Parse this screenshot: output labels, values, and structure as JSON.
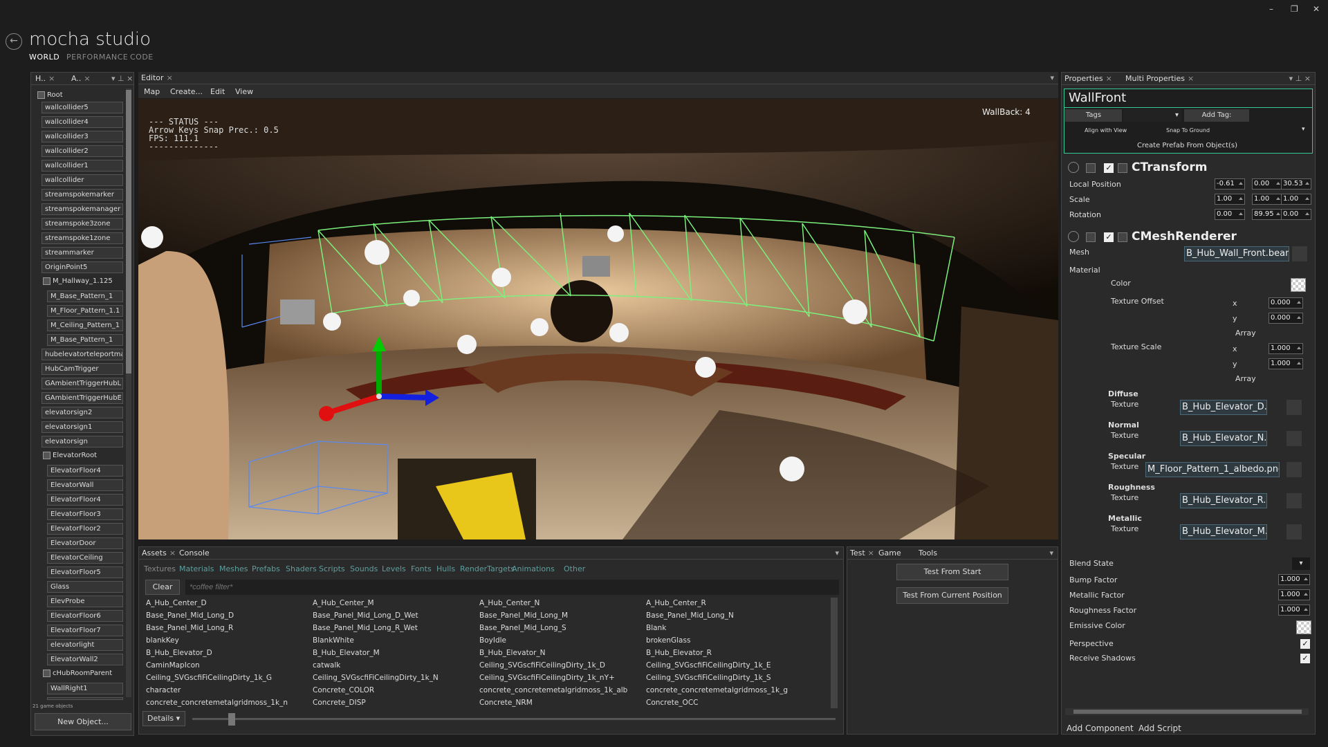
{
  "app": {
    "title": "mocha studio",
    "nav": [
      "WORLD",
      "PERFORMANCE",
      "CODE"
    ]
  },
  "window_controls": {
    "minimize": "–",
    "restore": "❐",
    "close": "✕"
  },
  "hierarchy": {
    "tabs": [
      "H..",
      "A.."
    ],
    "items": [
      "wallcollider5",
      "wallcollider4",
      "wallcollider3",
      "wallcollider2",
      "wallcollider1",
      "wallcollider",
      "streamspokemarker",
      "streamspokemanager",
      "streamspoke3zone",
      "streamspoke1zone",
      "streammarker",
      "OriginPoint5"
    ],
    "hallway_label": "M_Hallway_1.125",
    "hallway_children": [
      "M_Base_Pattern_1",
      "M_Floor_Pattern_1.1",
      "M_Ceiling_Pattern_1",
      "M_Base_Pattern_1"
    ],
    "items2": [
      "hubelevatorteleportma",
      "HubCamTrigger",
      "GAmbientTriggerHubL",
      "GAmbientTriggerHubE",
      "elevatorsign2",
      "elevatorsign1",
      "elevatorsign"
    ],
    "elevator_label": "ElevatorRoot",
    "elevator_children": [
      "ElevatorFloor4",
      "ElevatorWall",
      "ElevatorFloor4",
      "ElevatorFloor3",
      "ElevatorFloor2",
      "ElevatorDoor",
      "ElevatorCeiling",
      "ElevatorFloor5",
      "Glass",
      "ElevProbe",
      "ElevatorFloor6",
      "ElevatorFloor7",
      "elevatorlight",
      "ElevatorWall2"
    ],
    "hubroom_label": "cHubRoomParent",
    "hubroom_children": [
      "WallRight1",
      "WallRight"
    ],
    "root_label": "Root",
    "footer_count": "21 game objects",
    "new_object": "New Object..."
  },
  "editor": {
    "tab": "Editor",
    "menus": [
      "Map",
      "Create...",
      "Edit",
      "View"
    ],
    "status": "--- STATUS ---\nArrow Keys Snap Prec.: 0.5\nFPS: 111.1\n--------------",
    "overlay_label": "WallBack: 4"
  },
  "assets": {
    "tabs": [
      "Assets",
      "Console"
    ],
    "filters": [
      "Textures",
      "Materials",
      "Meshes",
      "Prefabs",
      "Shaders",
      "Scripts",
      "Sounds",
      "Levels",
      "Fonts",
      "Hulls",
      "RenderTargets",
      "Animations",
      "Other"
    ],
    "clear": "Clear",
    "filter_placeholder": "*coffee filter*",
    "rows": [
      [
        "A_Hub_Center_D",
        "A_Hub_Center_M",
        "A_Hub_Center_N",
        "A_Hub_Center_R"
      ],
      [
        "Base_Panel_Mid_Long_D",
        "Base_Panel_Mid_Long_D_Wet",
        "Base_Panel_Mid_Long_M",
        "Base_Panel_Mid_Long_N"
      ],
      [
        "Base_Panel_Mid_Long_R",
        "Base_Panel_Mid_Long_R_Wet",
        "Base_Panel_Mid_Long_S",
        "Blank"
      ],
      [
        "blankKey",
        "BlankWhite",
        "BoyIdle",
        "brokenGlass"
      ],
      [
        "B_Hub_Elevator_D",
        "B_Hub_Elevator_M",
        "B_Hub_Elevator_N",
        "B_Hub_Elevator_R"
      ],
      [
        "CaminMapIcon",
        "catwalk",
        "Ceiling_SVGscfiFiCeilingDirty_1k_D",
        "Ceiling_SVGscfiFiCeilingDirty_1k_E"
      ],
      [
        "Ceiling_SVGscfiFiCeilingDirty_1k_G",
        "Ceiling_SVGscfiFiCeilingDirty_1k_N",
        "Ceiling_SVGscfiFiCeilingDirty_1k_nY+",
        "Ceiling_SVGscfiFiCeilingDirty_1k_S"
      ],
      [
        "character",
        "Concrete_COLOR",
        "concrete_concretemetalgridmoss_1k_alb",
        "concrete_concretemetalgridmoss_1k_g"
      ],
      [
        "concrete_concretemetalgridmoss_1k_n",
        "Concrete_DISP",
        "Concrete_NRM",
        "Concrete_OCC"
      ]
    ],
    "details": "Details"
  },
  "test": {
    "tabs": [
      "Test",
      "Game",
      "Tools"
    ],
    "start": "Test From Start",
    "current": "Test From Current Position"
  },
  "properties": {
    "tabs": [
      "Properties",
      "Multi Properties"
    ],
    "object_name": "WallFront",
    "tags": "Tags",
    "add_tag": "Add Tag:",
    "align": "Align with View",
    "snap": "Snap To Ground",
    "prefab": "Create Prefab From Object(s)",
    "transform": {
      "name": "CTransform",
      "local_position_label": "Local Position",
      "local_position": [
        "-0.61",
        "0.00",
        "30.53"
      ],
      "scale_label": "Scale",
      "scale": [
        "1.00",
        "1.00",
        "1.00"
      ],
      "rotation_label": "Rotation",
      "rotation": [
        "0.00",
        "89.95",
        "0.00"
      ]
    },
    "renderer": {
      "name": "CMeshRenderer",
      "mesh_label": "Mesh",
      "mesh": "B_Hub_Wall_Front.bean",
      "material_label": "Material",
      "color_label": "Color",
      "texture_offset_label": "Texture Offset",
      "texture_scale_label": "Texture Scale",
      "x": "x",
      "y": "y",
      "array": "Array",
      "offset_x": "0.000",
      "offset_y": "0.000",
      "scale_x": "1.000",
      "scale_y": "1.000",
      "diffuse_label": "Diffuse",
      "normal_label": "Normal",
      "specular_label": "Specular",
      "roughness_label": "Roughness",
      "metallic_label": "Metallic",
      "texture_label": "Texture",
      "diffuse": "B_Hub_Elevator_D.png",
      "normal": "B_Hub_Elevator_N.png",
      "specular": "M_Floor_Pattern_1_albedo.png",
      "roughness": "B_Hub_Elevator_R.png",
      "metallic": "B_Hub_Elevator_M.png",
      "blend_state": "Blend State",
      "bump_factor_label": "Bump Factor",
      "bump_factor": "1.000",
      "metallic_factor_label": "Metallic Factor",
      "metallic_factor": "1.000",
      "roughness_factor_label": "Roughness Factor",
      "roughness_factor": "1.000",
      "emissive_label": "Emissive Color",
      "perspective_label": "Perspective",
      "receive_shadows_label": "Receive Shadows"
    },
    "add_component": "Add Component",
    "add_script": "Add Script"
  }
}
